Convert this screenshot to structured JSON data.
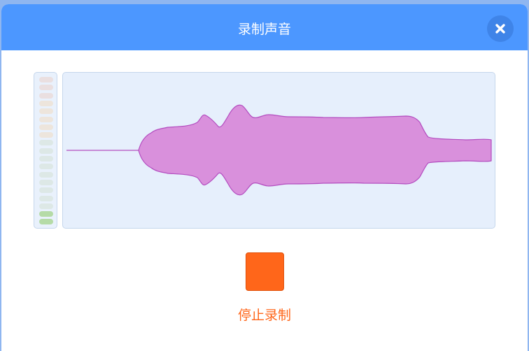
{
  "dialog": {
    "title": "录制声音",
    "close_icon": "close-icon"
  },
  "level_meter": {
    "segments": 19,
    "active_segments": 2,
    "active_color": "#b5dba7",
    "inactive_colors": [
      "#eadfe0",
      "#ede5dc",
      "#dde8e6"
    ]
  },
  "waveform": {
    "fill_color": "#d990dc",
    "stroke_color": "#b34cbf",
    "background_color": "#e6effc"
  },
  "recording": {
    "stop_icon": "stop-square-icon",
    "stop_label": "停止录制",
    "accent_color": "#ff661a"
  }
}
